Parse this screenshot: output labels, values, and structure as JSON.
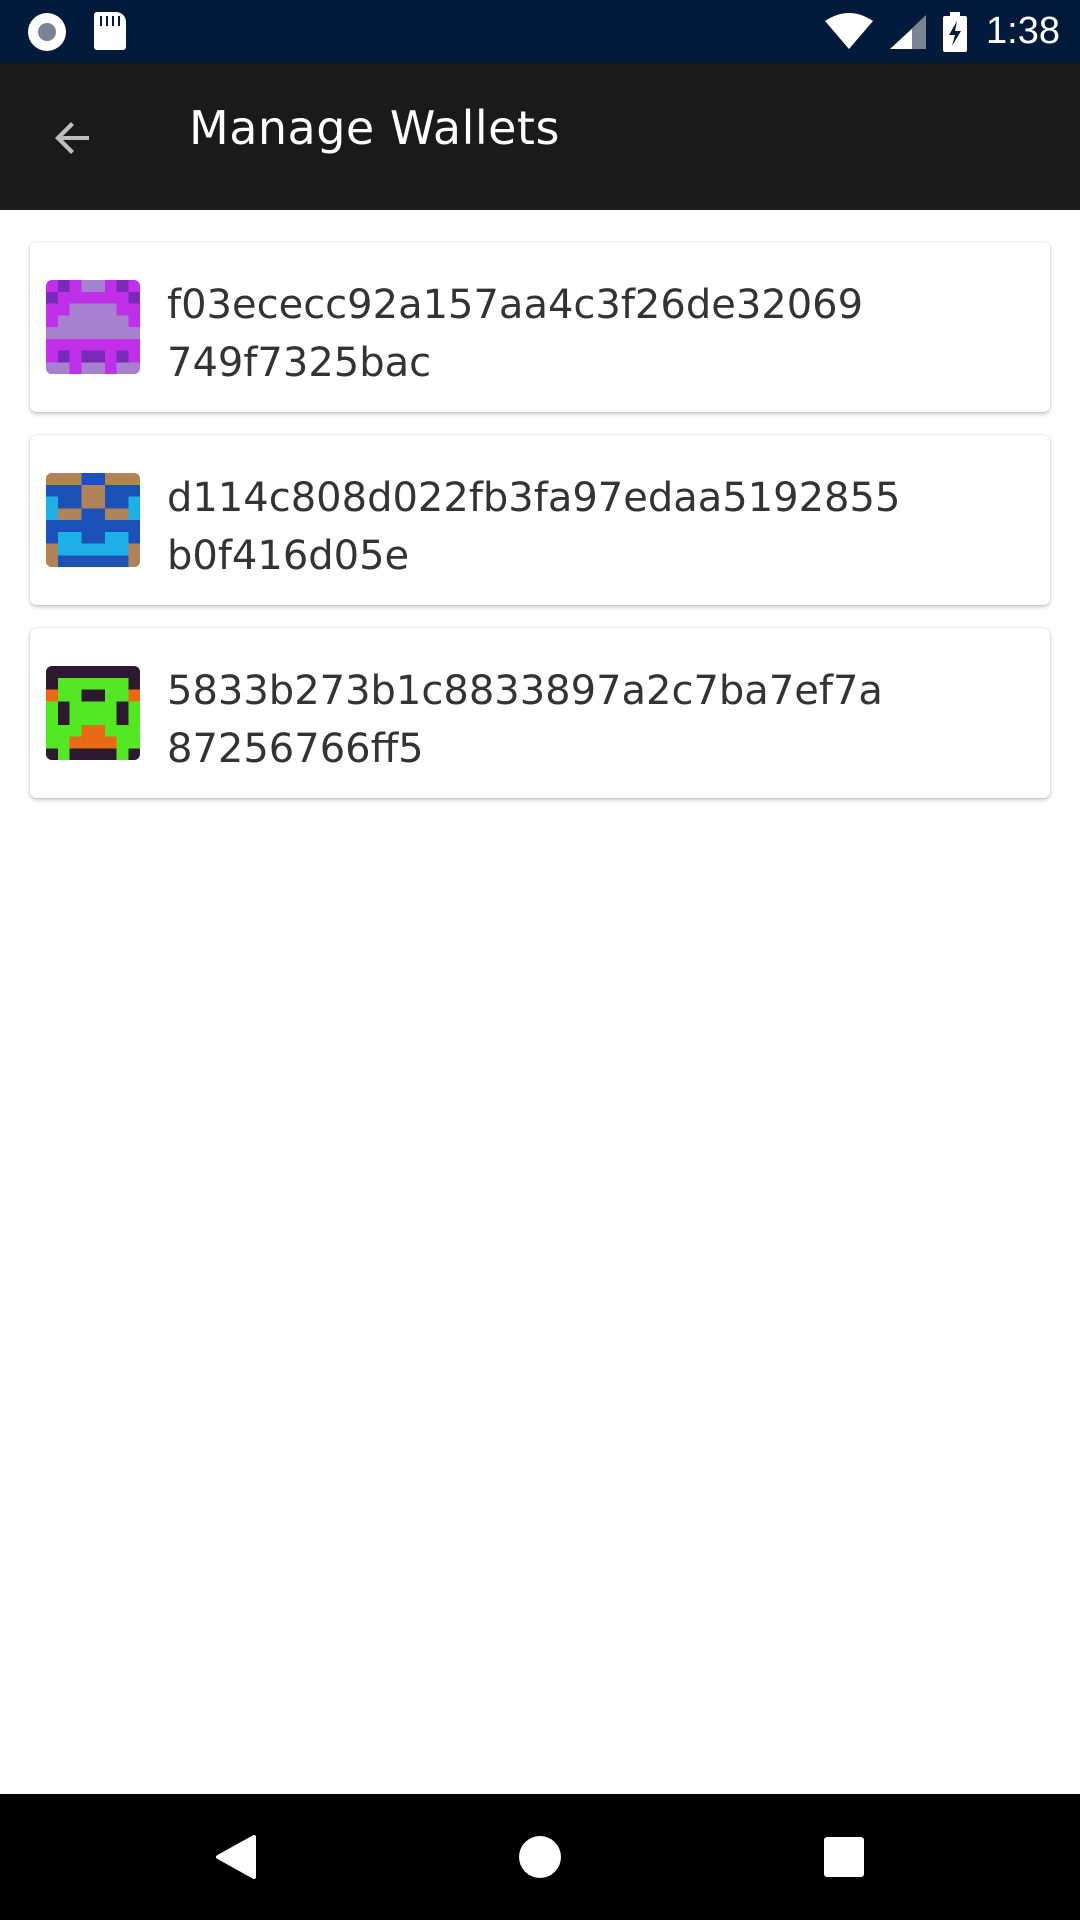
{
  "status_bar": {
    "time": "1:38",
    "icons": [
      "radio-icon",
      "sd-card-icon",
      "wifi-icon",
      "signal-icon",
      "battery-charging-icon"
    ]
  },
  "app_bar": {
    "title": "Manage Wallets",
    "back_icon": "arrow-back-icon"
  },
  "wallets": [
    {
      "address_line1": "f03ececc92a157aa4c3f26de32069",
      "address_line2": "749f7325bac",
      "identicon_colors": [
        "#c030e8",
        "#a880d0",
        "#7a2ab8"
      ]
    },
    {
      "address_line1": "d114c808d022fb3fa97edaa5192855",
      "address_line2": "b0f416d05e",
      "identicon_colors": [
        "#1c52b8",
        "#b08458",
        "#20b0e8"
      ]
    },
    {
      "address_line1": "5833b273b1c8833897a2c7ba7ef7a",
      "address_line2": "87256766ff5",
      "identicon_colors": [
        "#54e824",
        "#2e1a2e",
        "#e86a14"
      ]
    }
  ],
  "nav_bar": {
    "icons": [
      "back-triangle-icon",
      "home-circle-icon",
      "recents-square-icon"
    ]
  }
}
